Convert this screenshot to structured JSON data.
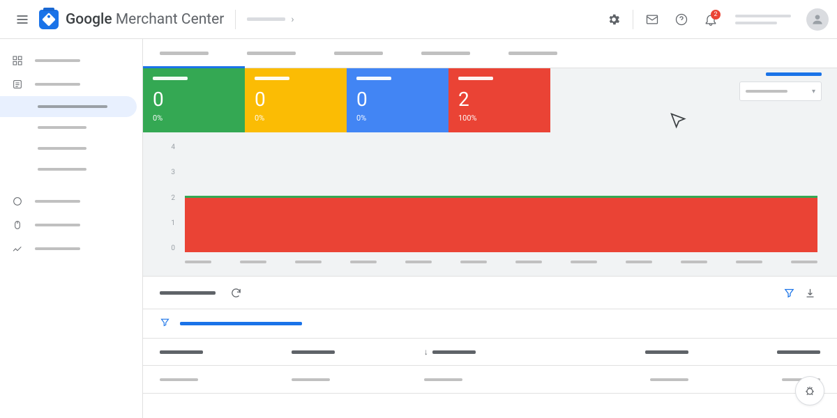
{
  "header": {
    "app_name_html": "Google Merchant Center",
    "notification_count": "2"
  },
  "stat_cards": [
    {
      "color": "green",
      "value": "0",
      "pct": "0%"
    },
    {
      "color": "yellow",
      "value": "0",
      "pct": "0%"
    },
    {
      "color": "blue",
      "value": "0",
      "pct": "0%"
    },
    {
      "color": "red",
      "value": "2",
      "pct": "100%"
    }
  ],
  "chart_data": {
    "type": "area",
    "ylim": [
      0,
      4
    ],
    "yticks": [
      "4",
      "3",
      "2",
      "1",
      "0"
    ],
    "x_count": 12,
    "series": [
      {
        "name": "disapproved",
        "color": "#ea4335",
        "value": 2
      },
      {
        "name": "active_line",
        "color": "#34a853",
        "value": 2
      }
    ],
    "title": "",
    "xlabel": "",
    "ylabel": ""
  },
  "table": {
    "columns": 5,
    "sort_col_index": 2,
    "sort_dir": "desc",
    "rows": 1
  },
  "colors": {
    "green": "#34a853",
    "yellow": "#fbbc04",
    "blue": "#4285f4",
    "red": "#ea4335",
    "accent": "#1a73e8"
  }
}
